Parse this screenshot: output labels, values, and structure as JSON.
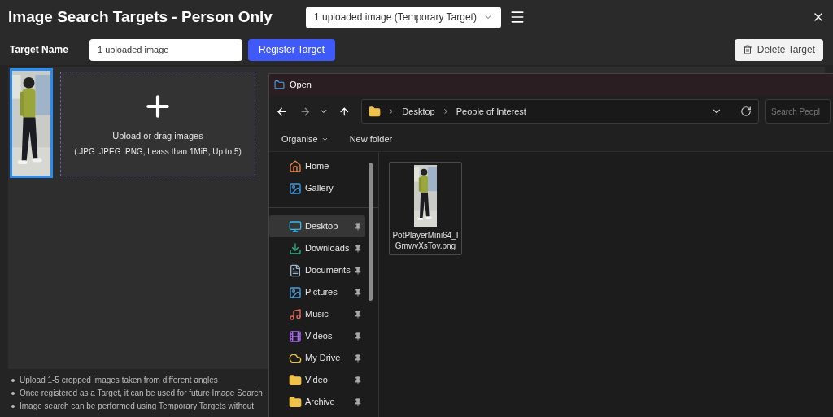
{
  "window": {
    "title": "Image Search Targets - Person Only"
  },
  "target_select": {
    "value": "1 uploaded image (Temporary Target)"
  },
  "target_name": {
    "label": "Target Name",
    "value": "1 uploaded image"
  },
  "register_button": {
    "label": "Register Target"
  },
  "delete_button": {
    "label": "Delete Target"
  },
  "images": [
    {
      "kind": "picture",
      "selected": true
    }
  ],
  "dropzone": {
    "title": "Upload or drag images",
    "hint": "(.JPG .JPEG .PNG, Leass than 1MiB, Up to 5)"
  },
  "notes": [
    "Upload 1-5 cropped images taken from different angles",
    "Once registered as a Target, it can be used for future Image Search",
    "Image search can be performed using Temporary Targets without"
  ],
  "dialog": {
    "title": "Open",
    "breadcrumb": [
      "Desktop",
      "People of Interest"
    ],
    "search": {
      "placeholder": "Search Peopl"
    },
    "toolbar": [
      {
        "label": "Organise",
        "kind": "menu"
      },
      {
        "label": "New folder",
        "kind": "button"
      }
    ],
    "nav_groups": [
      [
        {
          "name": "Home",
          "pinned": false,
          "selected": false
        },
        {
          "name": "Gallery",
          "pinned": false,
          "selected": false
        }
      ],
      [
        {
          "name": "Desktop",
          "pinned": true,
          "selected": true
        },
        {
          "name": "Downloads",
          "pinned": true,
          "selected": false
        },
        {
          "name": "Documents",
          "pinned": true,
          "selected": false
        },
        {
          "name": "Pictures",
          "pinned": true,
          "selected": false
        },
        {
          "name": "Music",
          "pinned": true,
          "selected": false
        },
        {
          "name": "Videos",
          "pinned": true,
          "selected": false
        },
        {
          "name": "My Drive",
          "pinned": true,
          "selected": false
        },
        {
          "name": "Video",
          "pinned": true,
          "selected": false
        },
        {
          "name": "Archive",
          "pinned": true,
          "selected": false
        }
      ]
    ],
    "files": [
      {
        "name": "PotPlayerMini64_IGmwvXsTov.png",
        "selected": true
      }
    ]
  }
}
